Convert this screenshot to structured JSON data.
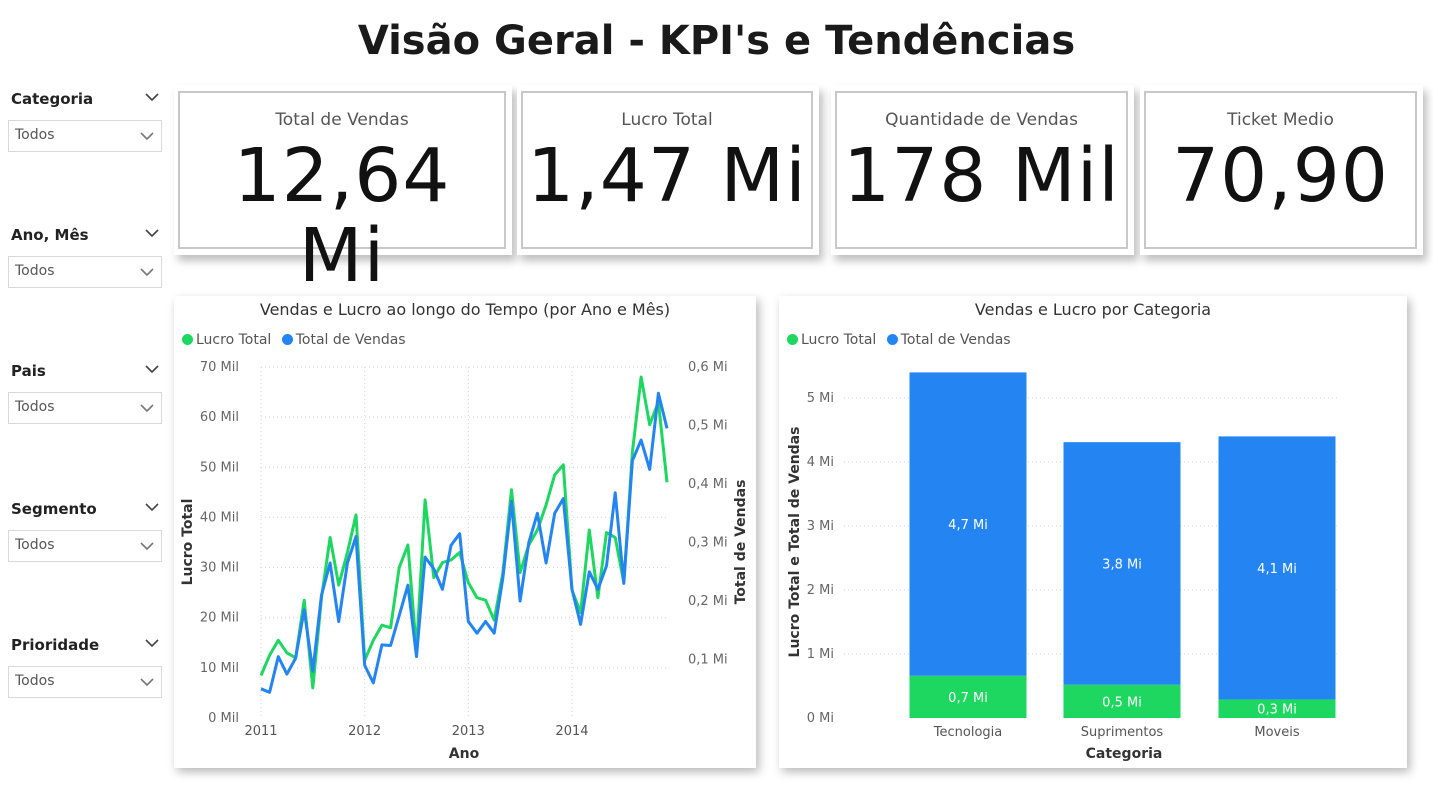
{
  "title": "Visão Geral - KPI's e Tendências",
  "slicers": [
    {
      "label": "Categoria",
      "value": "Todos"
    },
    {
      "label": "Ano, Mês",
      "value": "Todos"
    },
    {
      "label": "Pais",
      "value": "Todos"
    },
    {
      "label": "Segmento",
      "value": "Todos"
    },
    {
      "label": "Prioridade",
      "value": "Todos"
    }
  ],
  "kpis": [
    {
      "label": "Total de Vendas",
      "value": "12,64 Mi"
    },
    {
      "label": "Lucro Total",
      "value": "1,47 Mi"
    },
    {
      "label": "Quantidade de Vendas",
      "value": "178 Mil"
    },
    {
      "label": "Ticket Medio",
      "value": "70,90"
    }
  ],
  "colors": {
    "lucro": "#1ED760",
    "vendas": "#2384F2"
  },
  "line_chart": {
    "title": "Vendas e Lucro ao longo do Tempo (por Ano e Mês)",
    "legend": [
      "Lucro Total",
      "Total de Vendas"
    ],
    "xlabel": "Ano",
    "ylabel_left": "Lucro Total",
    "ylabel_right": "Total de Vendas",
    "x_ticks": [
      "2011",
      "2012",
      "2013",
      "2014"
    ],
    "y_left_ticks": [
      "0 Mil",
      "10 Mil",
      "20 Mil",
      "30 Mil",
      "40 Mil",
      "50 Mil",
      "60 Mil",
      "70 Mil"
    ],
    "y_right_ticks": [
      "0,1 Mi",
      "0,2 Mi",
      "0,3 Mi",
      "0,4 Mi",
      "0,5 Mi",
      "0,6 Mi"
    ]
  },
  "bar_chart": {
    "title": "Vendas e Lucro por Categoria",
    "legend": [
      "Lucro Total",
      "Total de Vendas"
    ],
    "xlabel": "Categoria",
    "ylabel": "Lucro Total e Total de Vendas",
    "y_ticks": [
      "0 Mi",
      "1 Mi",
      "2 Mi",
      "3 Mi",
      "4 Mi",
      "5 Mi"
    ],
    "categories": [
      "Tecnologia",
      "Suprimentos",
      "Moveis"
    ],
    "lucro_labels": [
      "0,7 Mi",
      "0,5 Mi",
      "0,3 Mi"
    ],
    "vendas_labels": [
      "4,7 Mi",
      "3,8 Mi",
      "4,1 Mi"
    ]
  },
  "chart_data": [
    {
      "type": "line",
      "title": "Vendas e Lucro ao longo do Tempo (por Ano e Mês)",
      "xlabel": "Ano",
      "ylabel": "Lucro Total",
      "y2label": "Total de Vendas",
      "x_range": [
        "2011-01",
        "2014-12"
      ],
      "ylim": [
        0,
        70000
      ],
      "y2lim": [
        0,
        0.6
      ],
      "series": [
        {
          "name": "Lucro Total",
          "axis": "left",
          "unit": "Mil",
          "values": [
            8.5,
            12.5,
            15.5,
            13,
            12,
            23.5,
            6,
            24,
            36,
            26.5,
            33,
            40.5,
            11.5,
            15.5,
            18.5,
            18,
            30,
            34.5,
            13.5,
            43.5,
            28,
            31,
            31.5,
            33,
            27,
            24,
            23.5,
            19.5,
            29,
            45.5,
            29,
            34.5,
            37.5,
            42.5,
            48.5,
            50.5,
            25.5,
            21,
            37.5,
            24,
            37,
            36,
            27,
            53,
            68,
            58.5,
            63,
            47
          ]
        },
        {
          "name": "Total de Vendas",
          "axis": "right",
          "unit": "Mi",
          "values": [
            0.05,
            0.044,
            0.105,
            0.075,
            0.102,
            0.185,
            0.08,
            0.21,
            0.265,
            0.165,
            0.265,
            0.31,
            0.09,
            0.06,
            0.125,
            0.124,
            0.175,
            0.227,
            0.105,
            0.275,
            0.255,
            0.22,
            0.295,
            0.315,
            0.165,
            0.145,
            0.165,
            0.145,
            0.24,
            0.37,
            0.2,
            0.3,
            0.35,
            0.265,
            0.35,
            0.375,
            0.22,
            0.16,
            0.25,
            0.22,
            0.26,
            0.385,
            0.23,
            0.44,
            0.475,
            0.425,
            0.555,
            0.495
          ]
        }
      ]
    },
    {
      "type": "bar",
      "stacked": true,
      "title": "Vendas e Lucro por Categoria",
      "xlabel": "Categoria",
      "ylabel": "Lucro Total e Total de Vendas",
      "categories": [
        "Tecnologia",
        "Suprimentos",
        "Moveis"
      ],
      "ylim": [
        0,
        5.5
      ],
      "series": [
        {
          "name": "Lucro Total",
          "values": [
            0.66,
            0.52,
            0.29
          ]
        },
        {
          "name": "Total de Vendas",
          "values": [
            4.74,
            3.79,
            4.11
          ]
        }
      ]
    }
  ]
}
